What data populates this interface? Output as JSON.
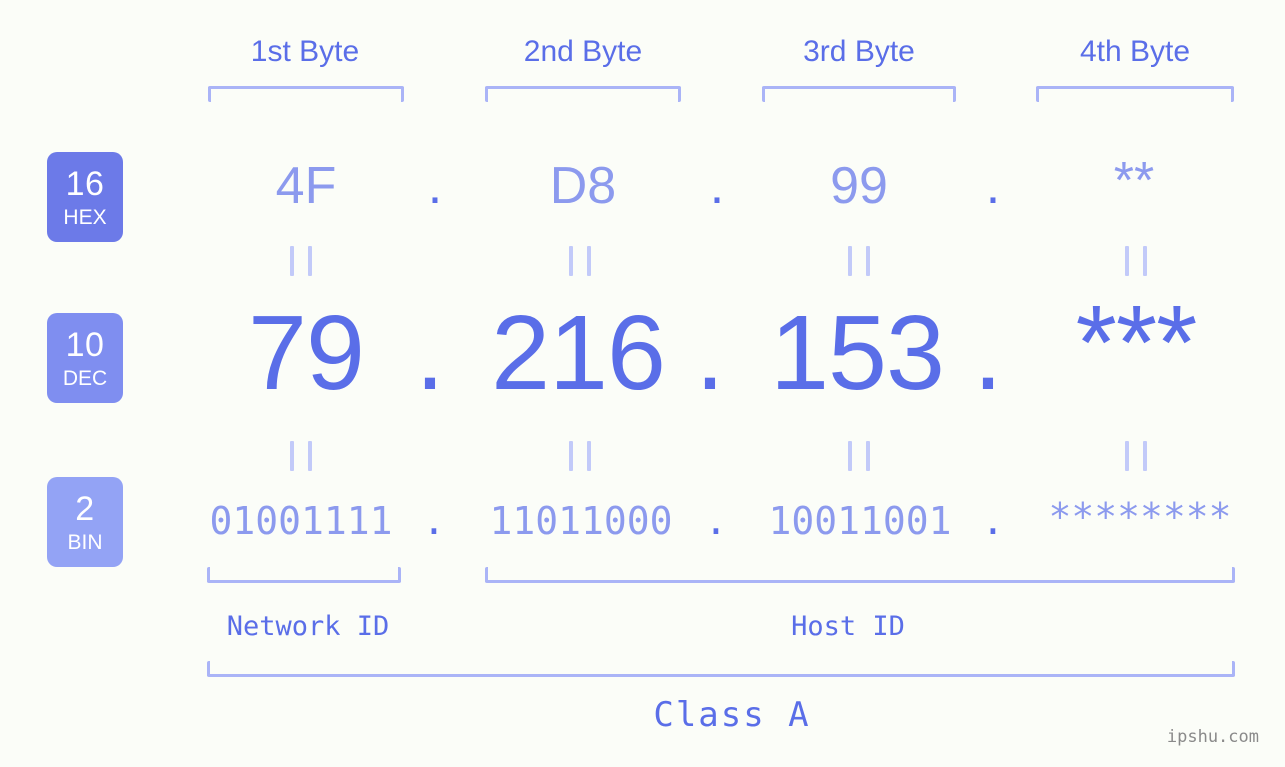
{
  "page": {
    "background_color": "#fbfdf8",
    "accent_color": "#5a6ee8",
    "accent_light_color": "#8c9aee",
    "bracket_color": "#aab4f7",
    "badge_color_hex": "#6c7ae8",
    "badge_color_dec": "#7f8ef0",
    "badge_color_bin": "#93a3f5"
  },
  "byte_headers": [
    {
      "label": "1st Byte"
    },
    {
      "label": "2nd Byte"
    },
    {
      "label": "3rd Byte"
    },
    {
      "label": "4th Byte"
    }
  ],
  "bases": [
    {
      "number": "16",
      "name": "HEX"
    },
    {
      "number": "10",
      "name": "DEC"
    },
    {
      "number": "2",
      "name": "BIN"
    }
  ],
  "rows": {
    "hex": {
      "base_number": "16",
      "base_name": "HEX",
      "values": [
        "4F",
        "D8",
        "99",
        "**"
      ],
      "separator": "."
    },
    "dec": {
      "base_number": "10",
      "base_name": "DEC",
      "values": [
        "79",
        "216",
        "153",
        "***"
      ],
      "separator": "."
    },
    "bin": {
      "base_number": "2",
      "base_name": "BIN",
      "values": [
        "01001111",
        "11011000",
        "10011001",
        "********"
      ],
      "separator": "."
    }
  },
  "equals_connectors": {
    "glyph": "||",
    "count_per_row": 4
  },
  "sections": [
    {
      "label": "Network ID"
    },
    {
      "label": "Host ID"
    }
  ],
  "class_label": "Class A",
  "watermark": "ipshu.com"
}
